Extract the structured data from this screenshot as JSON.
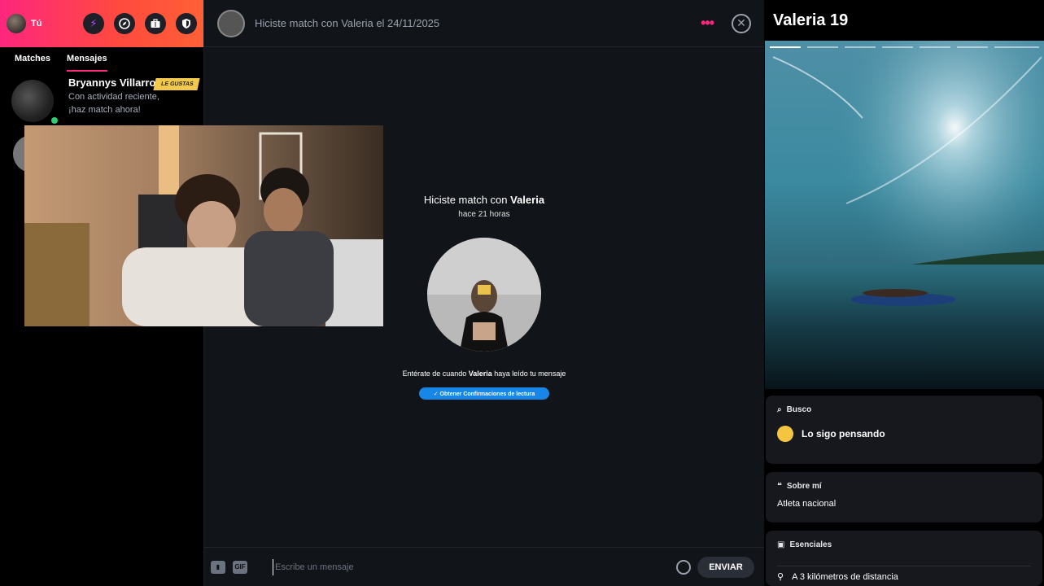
{
  "sidebar": {
    "me_label": "Tú",
    "tabs": [
      {
        "label": "Matches"
      },
      {
        "label": "Mensajes"
      }
    ],
    "match": {
      "name": "Bryannys Villarroel",
      "subtitle": "Con actividad reciente, ¡haz match ahora!",
      "badge": "LE GUSTAS"
    },
    "header_icons": [
      "bolt-icon",
      "compass-icon",
      "briefcase-icon",
      "shield-icon"
    ]
  },
  "chat": {
    "header_title": "Hiciste match con Valeria el 24/11/2025",
    "match_title_prefix": "Hiciste match con ",
    "match_name": "Valeria",
    "match_time": "hace 21 horas",
    "read_prefix": "Entérate de cuando ",
    "read_name": "Valeria",
    "read_suffix": " haya leído tu mensaje",
    "read_button": "✓ Obtener Confirmaciones de lectura",
    "composer": {
      "gif_label": "GIF",
      "placeholder": "Escribe un mensaje",
      "send_label": "ENVIAR"
    }
  },
  "profile": {
    "title": "Valeria 19",
    "busco_label": "Busco",
    "busco_value": "Lo sigo pensando",
    "about_label": "Sobre mí",
    "about_value": "Atleta nacional",
    "essentials_label": "Esenciales",
    "distance": "A 3 kilómetros de distancia"
  },
  "colors": {
    "brand_pink": "#fd267d",
    "brand_orange": "#ff6036",
    "read_button_blue": "#1786e6",
    "online_green": "#2ecc71",
    "badge_yellow": "#f2c94c"
  }
}
